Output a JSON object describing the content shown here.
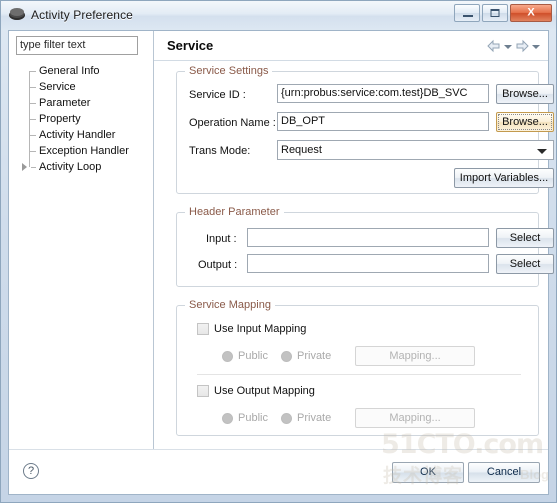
{
  "window": {
    "title": "Activity Preference",
    "icon": "preference-disc-icon",
    "controls": {
      "minimize": "minimize-button",
      "maximize": "maximize-button",
      "close_glyph": "X"
    }
  },
  "sidebar": {
    "filter": {
      "value": "type filter text",
      "placeholder": "type filter text"
    },
    "items": [
      {
        "label": "General Info",
        "expandable": false
      },
      {
        "label": "Service",
        "expandable": false
      },
      {
        "label": "Parameter",
        "expandable": false
      },
      {
        "label": "Property",
        "expandable": false
      },
      {
        "label": "Activity Handler",
        "expandable": false
      },
      {
        "label": "Exception Handler",
        "expandable": false
      },
      {
        "label": "Activity Loop",
        "expandable": true
      }
    ]
  },
  "main": {
    "page_title": "Service",
    "nav": {
      "back": "back-arrow",
      "forward": "forward-arrow"
    },
    "service_settings": {
      "legend": "Service Settings",
      "service_id": {
        "label": "Service ID :",
        "value": "{urn:probus:service:com.test}DB_SVC",
        "browse": "Browse..."
      },
      "operation_name": {
        "label": "Operation Name :",
        "value": "DB_OPT",
        "browse": "Browse..."
      },
      "trans_mode": {
        "label": "Trans Mode:",
        "value": "Request",
        "options": [
          "Request"
        ]
      },
      "import_variables": "Import Variables..."
    },
    "header_parameter": {
      "legend": "Header Parameter",
      "input": {
        "label": "Input :",
        "value": "",
        "button": "Select"
      },
      "output": {
        "label": "Output :",
        "value": "",
        "button": "Select"
      }
    },
    "service_mapping": {
      "legend": "Service Mapping",
      "input": {
        "checkbox_label": "Use Input Mapping",
        "checked": false,
        "public_label": "Public",
        "private_label": "Private",
        "mapping_button": "Mapping..."
      },
      "output": {
        "checkbox_label": "Use Output Mapping",
        "checked": false,
        "public_label": "Public",
        "private_label": "Private",
        "mapping_button": "Mapping..."
      }
    }
  },
  "footer": {
    "help": "?",
    "ok": "OK",
    "cancel": "Cancel"
  },
  "watermark": {
    "main": "51CTO.com",
    "sub": "技术博客",
    "blog": "Blog"
  },
  "colors": {
    "legend": "#8a5a49",
    "focus_border": "#c39a4e",
    "close_button": "#cf4f2a",
    "divider": "#b9c6d3"
  }
}
